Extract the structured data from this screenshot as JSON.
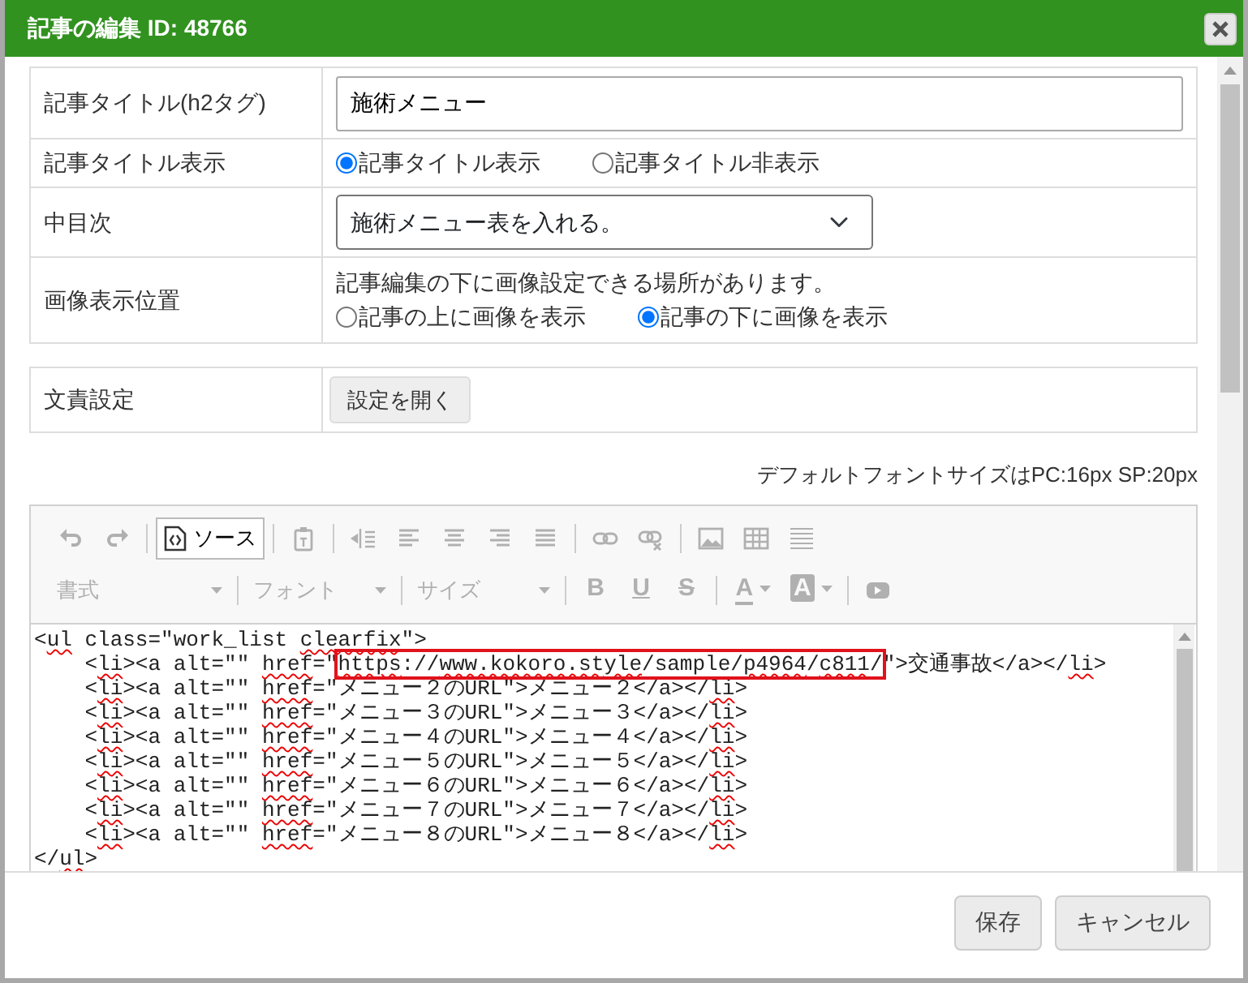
{
  "dialog": {
    "title": "記事の編集 ID: 48766"
  },
  "form": {
    "title_field": {
      "label": "記事タイトル(h2タグ)",
      "value": "施術メニュー"
    },
    "title_display": {
      "label": "記事タイトル表示",
      "options": [
        {
          "label": "記事タイトル表示",
          "selected": true
        },
        {
          "label": "記事タイトル非表示",
          "selected": false
        }
      ]
    },
    "subheading": {
      "label": "中目次",
      "value": "施術メニュー表を入れる。"
    },
    "image_position": {
      "label": "画像表示位置",
      "note": "記事編集の下に画像設定できる場所があります。",
      "options": [
        {
          "label": "記事の上に画像を表示",
          "selected": false
        },
        {
          "label": "記事の下に画像を表示",
          "selected": true
        }
      ]
    }
  },
  "responsibility": {
    "label": "文責設定",
    "button": "設定を開く"
  },
  "font_note": "デフォルトフォントサイズはPC:16px SP:20px",
  "editor": {
    "toolbar": {
      "disabled": true,
      "source_button": {
        "label": "ソース",
        "selected": true
      },
      "dropdowns": [
        "書式",
        "フォント",
        "サイズ"
      ],
      "format_buttons": [
        "B",
        "U",
        "S"
      ],
      "color_buttons": [
        "A",
        "A"
      ]
    },
    "code_lines": [
      [
        {
          "text": "<",
          "kind": "plain"
        },
        {
          "text": "ul",
          "kind": "misspelled"
        },
        {
          "text": " class=\"work_list ",
          "kind": "plain"
        },
        {
          "text": "clearfix",
          "kind": "misspelled"
        },
        {
          "text": "\">",
          "kind": "plain"
        }
      ],
      [
        {
          "text": "    <",
          "kind": "plain"
        },
        {
          "text": "li",
          "kind": "misspelled"
        },
        {
          "text": "><a alt=\"\" ",
          "kind": "plain"
        },
        {
          "text": "href",
          "kind": "misspelled"
        },
        {
          "text": "=\"",
          "kind": "plain"
        },
        {
          "kind": "boxed",
          "parts": [
            {
              "text": "https",
              "kind": "misspelled"
            },
            {
              "text": "://",
              "kind": "plain"
            },
            {
              "text": "www.kokoro.style",
              "kind": "misspelled"
            },
            {
              "text": "/sample/",
              "kind": "plain"
            },
            {
              "text": "p4964",
              "kind": "misspelled"
            },
            {
              "text": "/",
              "kind": "plain"
            },
            {
              "text": "c811",
              "kind": "misspelled"
            },
            {
              "text": "/",
              "kind": "plain"
            }
          ]
        },
        {
          "text": "\">交通事故</a></",
          "kind": "plain"
        },
        {
          "text": "li",
          "kind": "misspelled"
        },
        {
          "text": ">",
          "kind": "plain"
        }
      ],
      [
        {
          "text": "    <",
          "kind": "plain"
        },
        {
          "text": "li",
          "kind": "misspelled"
        },
        {
          "text": "><a alt=\"\" ",
          "kind": "plain"
        },
        {
          "text": "href",
          "kind": "misspelled"
        },
        {
          "text": "=\"メニュー２のURL\">メニュー２</a></",
          "kind": "plain"
        },
        {
          "text": "li",
          "kind": "misspelled"
        },
        {
          "text": ">",
          "kind": "plain"
        }
      ],
      [
        {
          "text": "    <",
          "kind": "plain"
        },
        {
          "text": "li",
          "kind": "misspelled"
        },
        {
          "text": "><a alt=\"\" ",
          "kind": "plain"
        },
        {
          "text": "href",
          "kind": "misspelled"
        },
        {
          "text": "=\"メニュー３のURL\">メニュー３</a></",
          "kind": "plain"
        },
        {
          "text": "li",
          "kind": "misspelled"
        },
        {
          "text": ">",
          "kind": "plain"
        }
      ],
      [
        {
          "text": "    <",
          "kind": "plain"
        },
        {
          "text": "li",
          "kind": "misspelled"
        },
        {
          "text": "><a alt=\"\" ",
          "kind": "plain"
        },
        {
          "text": "href",
          "kind": "misspelled"
        },
        {
          "text": "=\"メニュー４のURL\">メニュー４</a></",
          "kind": "plain"
        },
        {
          "text": "li",
          "kind": "misspelled"
        },
        {
          "text": ">",
          "kind": "plain"
        }
      ],
      [
        {
          "text": "    <",
          "kind": "plain"
        },
        {
          "text": "li",
          "kind": "misspelled"
        },
        {
          "text": "><a alt=\"\" ",
          "kind": "plain"
        },
        {
          "text": "href",
          "kind": "misspelled"
        },
        {
          "text": "=\"メニュー５のURL\">メニュー５</a></",
          "kind": "plain"
        },
        {
          "text": "li",
          "kind": "misspelled"
        },
        {
          "text": ">",
          "kind": "plain"
        }
      ],
      [
        {
          "text": "    <",
          "kind": "plain"
        },
        {
          "text": "li",
          "kind": "misspelled"
        },
        {
          "text": "><a alt=\"\" ",
          "kind": "plain"
        },
        {
          "text": "href",
          "kind": "misspelled"
        },
        {
          "text": "=\"メニュー６のURL\">メニュー６</a></",
          "kind": "plain"
        },
        {
          "text": "li",
          "kind": "misspelled"
        },
        {
          "text": ">",
          "kind": "plain"
        }
      ],
      [
        {
          "text": "    <",
          "kind": "plain"
        },
        {
          "text": "li",
          "kind": "misspelled"
        },
        {
          "text": "><a alt=\"\" ",
          "kind": "plain"
        },
        {
          "text": "href",
          "kind": "misspelled"
        },
        {
          "text": "=\"メニュー７のURL\">メニュー７</a></",
          "kind": "plain"
        },
        {
          "text": "li",
          "kind": "misspelled"
        },
        {
          "text": ">",
          "kind": "plain"
        }
      ],
      [
        {
          "text": "    <",
          "kind": "plain"
        },
        {
          "text": "li",
          "kind": "misspelled"
        },
        {
          "text": "><a alt=\"\" ",
          "kind": "plain"
        },
        {
          "text": "href",
          "kind": "misspelled"
        },
        {
          "text": "=\"メニュー８のURL\">メニュー８</a></",
          "kind": "plain"
        },
        {
          "text": "li",
          "kind": "misspelled"
        },
        {
          "text": ">",
          "kind": "plain"
        }
      ],
      [
        {
          "text": "</",
          "kind": "plain"
        },
        {
          "text": "ul",
          "kind": "misspelled"
        },
        {
          "text": ">",
          "kind": "plain"
        }
      ]
    ]
  },
  "buttons": [
    {
      "label": "保存"
    },
    {
      "label": "キャンセル"
    }
  ]
}
